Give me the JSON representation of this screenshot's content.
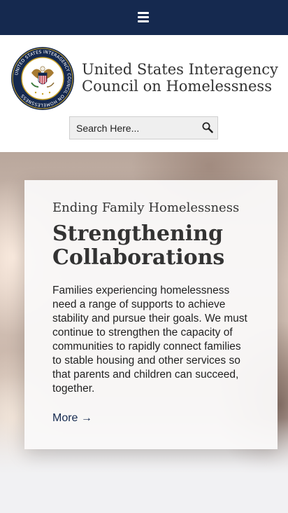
{
  "topbar": {
    "menu_icon": "hamburger-menu-icon"
  },
  "header": {
    "org_name_line1": "United States Interagency",
    "org_name_line2": "Council on Homelessness",
    "seal_text": "UNITED STATES INTERAGENCY COUNCIL ON HOMELESSNESS"
  },
  "search": {
    "placeholder": "Search Here...",
    "icon": "search-icon"
  },
  "hero": {
    "eyebrow": "Ending Family Homelessness",
    "headline": "Strengthening Collaborations",
    "body": "Families experiencing homelessness need a range of supports to achieve stability and pursue their goals. We must continue to strengthen the capacity of communities to rapidly connect families to stable housing and other services so that parents and children can succeed, together.",
    "more_label": "More →"
  },
  "colors": {
    "navy": "#15294f",
    "gold": "#c9a227",
    "text": "#333333"
  }
}
